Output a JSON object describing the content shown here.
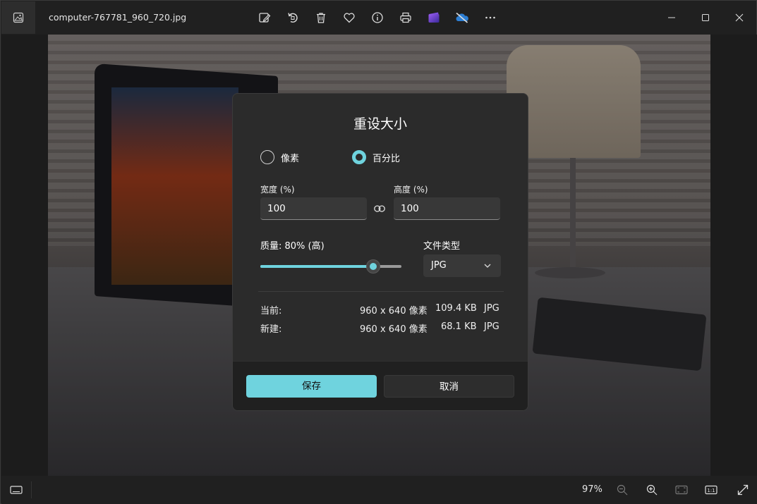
{
  "titlebar": {
    "file_name": "computer-767781_960_720.jpg",
    "toolbar_icons": [
      "edit-image-icon",
      "rotate-icon",
      "delete-icon",
      "favorite-icon",
      "info-icon",
      "print-icon",
      "clipchamp-icon",
      "onedrive-icon",
      "more-icon"
    ]
  },
  "dialog": {
    "title": "重设大小",
    "mode_pixels": "像素",
    "mode_percent": "百分比",
    "selected_mode": "percent",
    "width_label": "宽度 (%)",
    "width_value": "100",
    "height_label": "高度 (%)",
    "height_value": "100",
    "quality_label": "质量: 80% (高)",
    "quality_value": 0.8,
    "filetype_label": "文件类型",
    "filetype_value": "JPG",
    "current_label": "当前:",
    "current_dims": "960 x 640 像素",
    "current_size": "109.4 KB",
    "current_type": "JPG",
    "new_label": "新建:",
    "new_dims": "960 x 640 像素",
    "new_size": "68.1 KB",
    "new_type": "JPG",
    "save_label": "保存",
    "cancel_label": "取消"
  },
  "statusbar": {
    "zoom": "97%"
  },
  "colors": {
    "accent": "#6fd3de",
    "background": "#202020",
    "dialog": "#2b2b2b"
  }
}
